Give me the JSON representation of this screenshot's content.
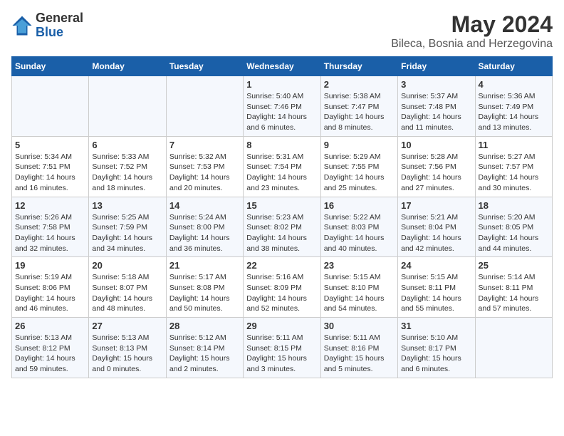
{
  "app": {
    "logo_general": "General",
    "logo_blue": "Blue",
    "month_year": "May 2024",
    "location": "Bileca, Bosnia and Herzegovina"
  },
  "calendar": {
    "headers": [
      "Sunday",
      "Monday",
      "Tuesday",
      "Wednesday",
      "Thursday",
      "Friday",
      "Saturday"
    ],
    "weeks": [
      [
        {
          "day": "",
          "info": ""
        },
        {
          "day": "",
          "info": ""
        },
        {
          "day": "",
          "info": ""
        },
        {
          "day": "1",
          "info": "Sunrise: 5:40 AM\nSunset: 7:46 PM\nDaylight: 14 hours\nand 6 minutes."
        },
        {
          "day": "2",
          "info": "Sunrise: 5:38 AM\nSunset: 7:47 PM\nDaylight: 14 hours\nand 8 minutes."
        },
        {
          "day": "3",
          "info": "Sunrise: 5:37 AM\nSunset: 7:48 PM\nDaylight: 14 hours\nand 11 minutes."
        },
        {
          "day": "4",
          "info": "Sunrise: 5:36 AM\nSunset: 7:49 PM\nDaylight: 14 hours\nand 13 minutes."
        }
      ],
      [
        {
          "day": "5",
          "info": "Sunrise: 5:34 AM\nSunset: 7:51 PM\nDaylight: 14 hours\nand 16 minutes."
        },
        {
          "day": "6",
          "info": "Sunrise: 5:33 AM\nSunset: 7:52 PM\nDaylight: 14 hours\nand 18 minutes."
        },
        {
          "day": "7",
          "info": "Sunrise: 5:32 AM\nSunset: 7:53 PM\nDaylight: 14 hours\nand 20 minutes."
        },
        {
          "day": "8",
          "info": "Sunrise: 5:31 AM\nSunset: 7:54 PM\nDaylight: 14 hours\nand 23 minutes."
        },
        {
          "day": "9",
          "info": "Sunrise: 5:29 AM\nSunset: 7:55 PM\nDaylight: 14 hours\nand 25 minutes."
        },
        {
          "day": "10",
          "info": "Sunrise: 5:28 AM\nSunset: 7:56 PM\nDaylight: 14 hours\nand 27 minutes."
        },
        {
          "day": "11",
          "info": "Sunrise: 5:27 AM\nSunset: 7:57 PM\nDaylight: 14 hours\nand 30 minutes."
        }
      ],
      [
        {
          "day": "12",
          "info": "Sunrise: 5:26 AM\nSunset: 7:58 PM\nDaylight: 14 hours\nand 32 minutes."
        },
        {
          "day": "13",
          "info": "Sunrise: 5:25 AM\nSunset: 7:59 PM\nDaylight: 14 hours\nand 34 minutes."
        },
        {
          "day": "14",
          "info": "Sunrise: 5:24 AM\nSunset: 8:00 PM\nDaylight: 14 hours\nand 36 minutes."
        },
        {
          "day": "15",
          "info": "Sunrise: 5:23 AM\nSunset: 8:02 PM\nDaylight: 14 hours\nand 38 minutes."
        },
        {
          "day": "16",
          "info": "Sunrise: 5:22 AM\nSunset: 8:03 PM\nDaylight: 14 hours\nand 40 minutes."
        },
        {
          "day": "17",
          "info": "Sunrise: 5:21 AM\nSunset: 8:04 PM\nDaylight: 14 hours\nand 42 minutes."
        },
        {
          "day": "18",
          "info": "Sunrise: 5:20 AM\nSunset: 8:05 PM\nDaylight: 14 hours\nand 44 minutes."
        }
      ],
      [
        {
          "day": "19",
          "info": "Sunrise: 5:19 AM\nSunset: 8:06 PM\nDaylight: 14 hours\nand 46 minutes."
        },
        {
          "day": "20",
          "info": "Sunrise: 5:18 AM\nSunset: 8:07 PM\nDaylight: 14 hours\nand 48 minutes."
        },
        {
          "day": "21",
          "info": "Sunrise: 5:17 AM\nSunset: 8:08 PM\nDaylight: 14 hours\nand 50 minutes."
        },
        {
          "day": "22",
          "info": "Sunrise: 5:16 AM\nSunset: 8:09 PM\nDaylight: 14 hours\nand 52 minutes."
        },
        {
          "day": "23",
          "info": "Sunrise: 5:15 AM\nSunset: 8:10 PM\nDaylight: 14 hours\nand 54 minutes."
        },
        {
          "day": "24",
          "info": "Sunrise: 5:15 AM\nSunset: 8:11 PM\nDaylight: 14 hours\nand 55 minutes."
        },
        {
          "day": "25",
          "info": "Sunrise: 5:14 AM\nSunset: 8:11 PM\nDaylight: 14 hours\nand 57 minutes."
        }
      ],
      [
        {
          "day": "26",
          "info": "Sunrise: 5:13 AM\nSunset: 8:12 PM\nDaylight: 14 hours\nand 59 minutes."
        },
        {
          "day": "27",
          "info": "Sunrise: 5:13 AM\nSunset: 8:13 PM\nDaylight: 15 hours\nand 0 minutes."
        },
        {
          "day": "28",
          "info": "Sunrise: 5:12 AM\nSunset: 8:14 PM\nDaylight: 15 hours\nand 2 minutes."
        },
        {
          "day": "29",
          "info": "Sunrise: 5:11 AM\nSunset: 8:15 PM\nDaylight: 15 hours\nand 3 minutes."
        },
        {
          "day": "30",
          "info": "Sunrise: 5:11 AM\nSunset: 8:16 PM\nDaylight: 15 hours\nand 5 minutes."
        },
        {
          "day": "31",
          "info": "Sunrise: 5:10 AM\nSunset: 8:17 PM\nDaylight: 15 hours\nand 6 minutes."
        },
        {
          "day": "",
          "info": ""
        }
      ]
    ]
  }
}
